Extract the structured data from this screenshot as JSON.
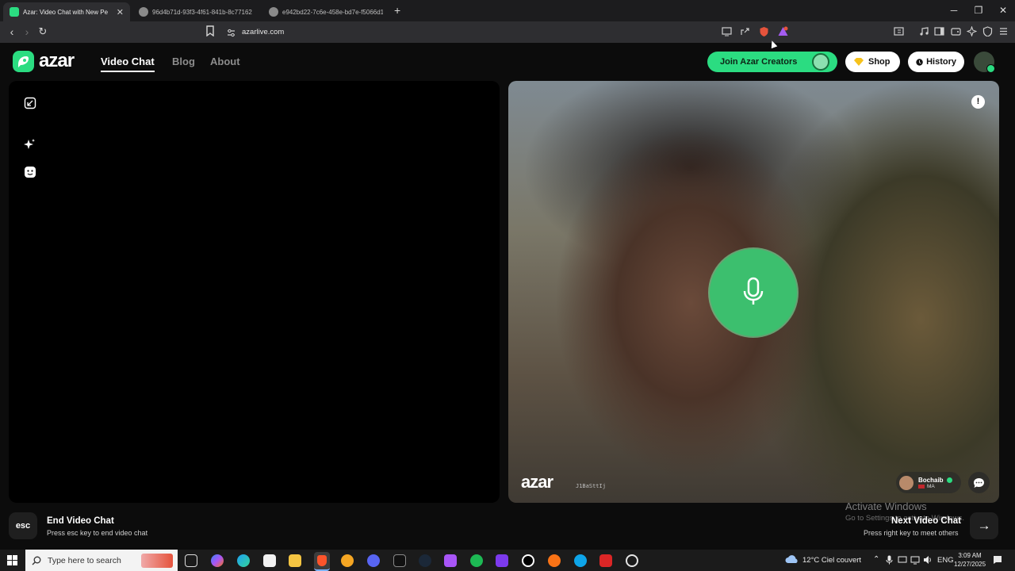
{
  "browser": {
    "tabs": [
      {
        "title": "Azar: Video Chat with New Pe",
        "favicon_color": "#2bdc81",
        "active": true
      },
      {
        "title": "96d4b71d-93f3-4f61-841b-8c77162",
        "favicon_color": "#9e9e9e",
        "active": false
      },
      {
        "title": "e942bd22-7c6e-458e-bd7e-f5066d1",
        "favicon_color": "#9e9e9e",
        "active": false
      }
    ],
    "new_tab_icon": "plus-icon",
    "url": "azarlive.com"
  },
  "site": {
    "logo_text": "azar",
    "nav": [
      {
        "label": "Video Chat",
        "active": true
      },
      {
        "label": "Blog",
        "active": false
      },
      {
        "label": "About",
        "active": false
      }
    ],
    "join_label": "Join Azar Creators",
    "shop_label": "Shop",
    "history_label": "History",
    "accent": "#2bdc81"
  },
  "video": {
    "watermark": "azar",
    "watermark_id": "J1BaSttIj",
    "shield_glyph": "!",
    "partner": {
      "name": "Bochaib",
      "country": "MA"
    }
  },
  "controls": {
    "end_key": "esc",
    "end_title": "End Video Chat",
    "end_sub": "Press esc key to end video chat",
    "next_title": "Next Video Chat",
    "next_sub": "Press right key to meet others"
  },
  "os_overlay": {
    "activate_title": "Activate Windows",
    "activate_sub": "Go to Settings to activate Windows."
  },
  "taskbar": {
    "search_placeholder": "Type here to search",
    "weather": "12°C  Ciel couvert",
    "language": "ENG",
    "time": "3:09 AM",
    "date": "12/27/2025"
  }
}
